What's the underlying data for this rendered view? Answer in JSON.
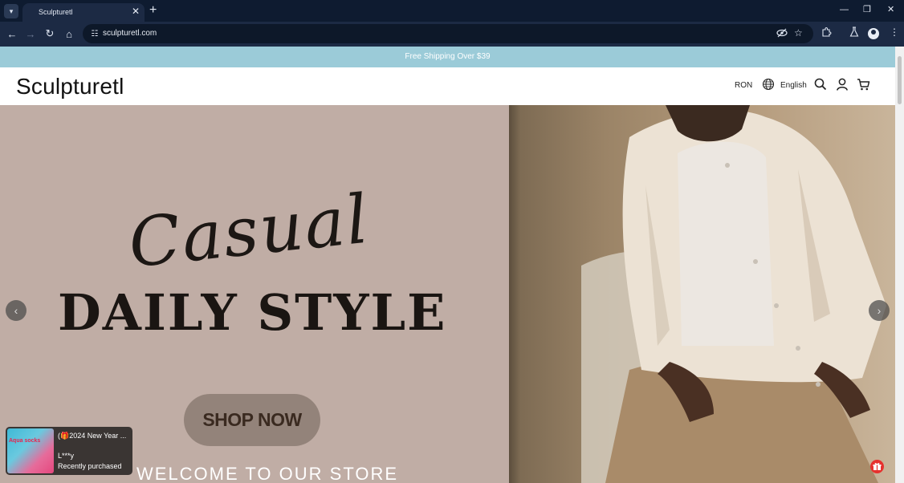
{
  "browser": {
    "tab_title": "Sculpturetl",
    "url": "sculpturetl.com",
    "tab_close": "✕",
    "new_tab": "+",
    "icons": [
      "tab-search-icon",
      "back-icon",
      "forward-icon",
      "reload-icon",
      "home-icon",
      "site-info-icon",
      "eye-off-icon",
      "star-icon",
      "extensions-icon",
      "labs-icon",
      "profile-icon",
      "menu-icon",
      "minimize-icon",
      "restore-icon",
      "close-icon"
    ]
  },
  "announcement": {
    "text": "Free Shipping Over $39"
  },
  "header": {
    "logo": "Sculpturetl",
    "currency": "RON",
    "language": "English",
    "icons": [
      "globe-icon",
      "search-icon",
      "account-icon",
      "cart-icon"
    ]
  },
  "hero": {
    "script_title": "Casual",
    "headline": "DAILY STYLE",
    "cta": "SHOP NOW",
    "welcome": "WELCOME TO OUR STORE",
    "prev_arrow": "‹",
    "next_arrow": "›"
  },
  "purchase_popup": {
    "thumb_text": "Aqua socks",
    "title": "(🎁2024 New Year ...",
    "name": "L***y",
    "subtitle": "Recently purchased"
  },
  "colors": {
    "announcement_bg": "#9bcbd8",
    "hero_bg": "#c0ada5",
    "cta_bg": "#93837a",
    "browser_dark": "#0e1b30",
    "gift_badge": "#e6312e"
  }
}
